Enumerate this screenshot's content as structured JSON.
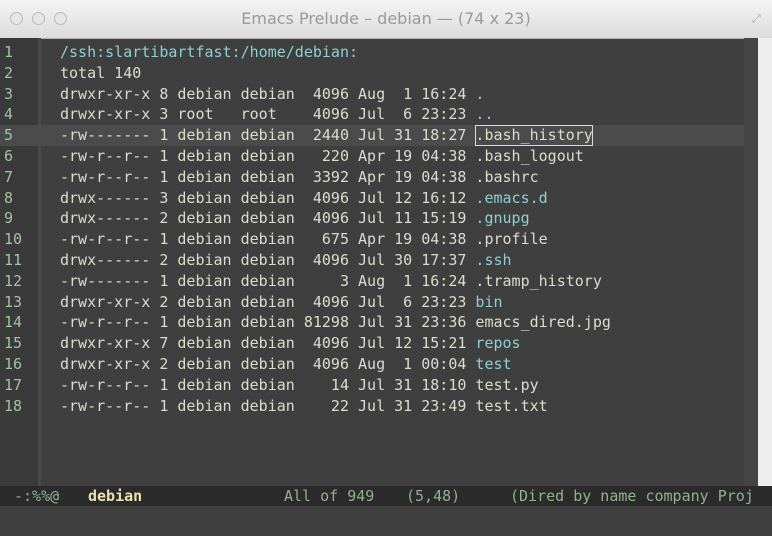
{
  "window": {
    "title": "Emacs Prelude – debian  —  (74 x 23)"
  },
  "buffer": {
    "lines": [
      {
        "n": "1",
        "text": "/ssh:slartibartfast:/home/debian:",
        "kind": "header"
      },
      {
        "n": "2",
        "text": "total 140",
        "kind": "plain"
      },
      {
        "n": "3",
        "perm": "drwxr-xr-x 8 debian debian  4096 Aug  1 16:24 ",
        "name": ".",
        "kind": "dir"
      },
      {
        "n": "4",
        "perm": "drwxr-xr-x 3 root   root    4096 Jul  6 23:23 ",
        "name": "..",
        "kind": "dir"
      },
      {
        "n": "5",
        "perm": "-rw------- 1 debian debian  2440 Jul 31 18:27 ",
        "name": ".bash_history",
        "kind": "file",
        "current": true
      },
      {
        "n": "6",
        "perm": "-rw-r--r-- 1 debian debian   220 Apr 19 04:38 ",
        "name": ".bash_logout",
        "kind": "file"
      },
      {
        "n": "7",
        "perm": "-rw-r--r-- 1 debian debian  3392 Apr 19 04:38 ",
        "name": ".bashrc",
        "kind": "file"
      },
      {
        "n": "8",
        "perm": "drwx------ 3 debian debian  4096 Jul 12 16:12 ",
        "name": ".emacs.d",
        "kind": "dir"
      },
      {
        "n": "9",
        "perm": "drwx------ 2 debian debian  4096 Jul 11 15:19 ",
        "name": ".gnupg",
        "kind": "dir"
      },
      {
        "n": "10",
        "perm": "-rw-r--r-- 1 debian debian   675 Apr 19 04:38 ",
        "name": ".profile",
        "kind": "file"
      },
      {
        "n": "11",
        "perm": "drwx------ 2 debian debian  4096 Jul 30 17:37 ",
        "name": ".ssh",
        "kind": "dir"
      },
      {
        "n": "12",
        "perm": "-rw------- 1 debian debian     3 Aug  1 16:24 ",
        "name": ".tramp_history",
        "kind": "file"
      },
      {
        "n": "13",
        "perm": "drwxr-xr-x 2 debian debian  4096 Jul  6 23:23 ",
        "name": "bin",
        "kind": "dir"
      },
      {
        "n": "14",
        "perm": "-rw-r--r-- 1 debian debian 81298 Jul 31 23:36 ",
        "name": "emacs_dired.jpg",
        "kind": "file"
      },
      {
        "n": "15",
        "perm": "drwxr-xr-x 7 debian debian  4096 Jul 12 15:21 ",
        "name": "repos",
        "kind": "dir"
      },
      {
        "n": "16",
        "perm": "drwxr-xr-x 2 debian debian  4096 Aug  1 00:04 ",
        "name": "test",
        "kind": "dir"
      },
      {
        "n": "17",
        "perm": "-rw-r--r-- 1 debian debian    14 Jul 31 18:10 ",
        "name": "test.py",
        "kind": "file"
      },
      {
        "n": "18",
        "perm": "-rw-r--r-- 1 debian debian    22 Jul 31 23:49 ",
        "name": "test.txt",
        "kind": "file"
      }
    ]
  },
  "modeline": {
    "status": "-:%%@",
    "buffer_name": "debian",
    "position": "All of 949",
    "cursor": "(5,48)",
    "modes": "(Dired by name company Proj"
  },
  "colors": {
    "background": "#3f3f3f",
    "directory": "#8cd0d3",
    "text": "#dcdccc",
    "line_numbers": "#9fc59f",
    "modeline_bg": "#2b2b2b"
  }
}
